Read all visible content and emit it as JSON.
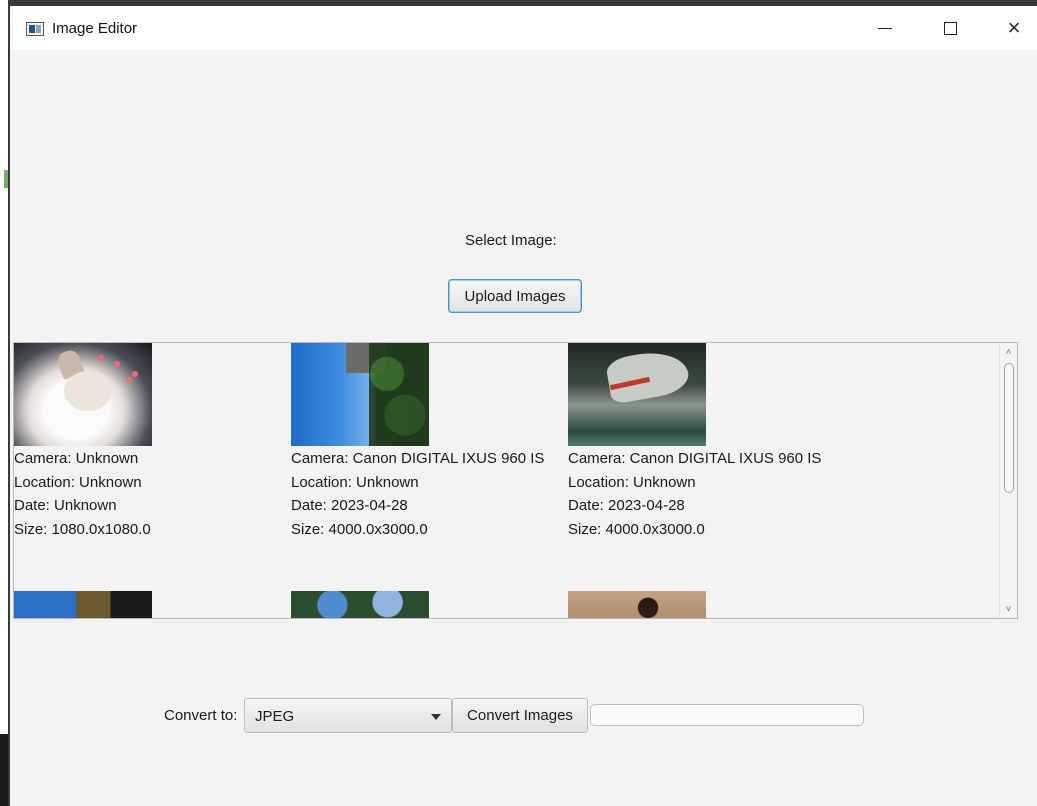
{
  "window": {
    "title": "Image Editor",
    "controls": {
      "minimize": "minimize",
      "maximize": "maximize",
      "close": "×"
    }
  },
  "select_label": "Select Image:",
  "upload_button": "Upload Images",
  "gallery": {
    "images": [
      {
        "thumbnail": "cat-photo",
        "camera": "Camera: Unknown",
        "location": "Location: Unknown",
        "date": "Date: Unknown",
        "size": "Size: 1080.0x1080.0"
      },
      {
        "thumbnail": "sky-trees-photo",
        "camera": "Camera: Canon DIGITAL IXUS 960 IS",
        "location": "Location: Unknown",
        "date": "Date: 2023-04-28",
        "size": "Size: 4000.0x3000.0"
      },
      {
        "thumbnail": "object-photo",
        "camera": "Camera: Canon DIGITAL IXUS 960 IS",
        "location": "Location: Unknown",
        "date": "Date: 2023-04-28",
        "size": "Size: 4000.0x3000.0"
      }
    ],
    "scroll_up_icon": "chevron-up-icon",
    "scroll_down_icon": "chevron-down-icon"
  },
  "convert": {
    "label": "Convert to:",
    "format_selected": "JPEG",
    "button": "Convert Images",
    "progress": 0
  },
  "colors": {
    "accent": "#3b93d3",
    "window_bg": "#f3f3f3",
    "titlebar_bg": "#ffffff"
  }
}
